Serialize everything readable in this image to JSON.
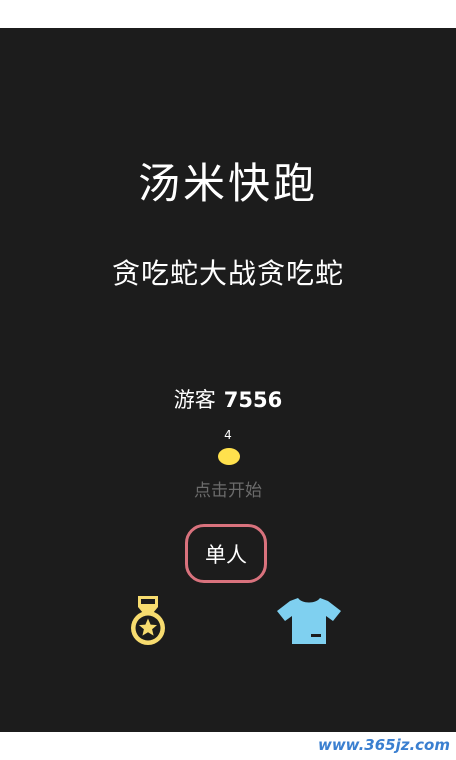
{
  "game": {
    "title": "汤米快跑",
    "subtitle": "贪吃蛇大战贪吃蛇",
    "player_label": "游客",
    "player_score": "7556",
    "coin_count": "4",
    "tap_to_start": "点击开始",
    "single_player_label": "单人"
  },
  "icons": {
    "coin": "coin-icon",
    "medal": "medal-star-icon",
    "shirt": "t-shirt-icon"
  },
  "colors": {
    "background": "#1c1c1c",
    "coin": "#ffe14d",
    "medal": "#f7dc6f",
    "shirt": "#7fd0f0",
    "button_border": "#d9727d",
    "muted_text": "#6b6b6b"
  },
  "watermark": "www.365jz.com"
}
